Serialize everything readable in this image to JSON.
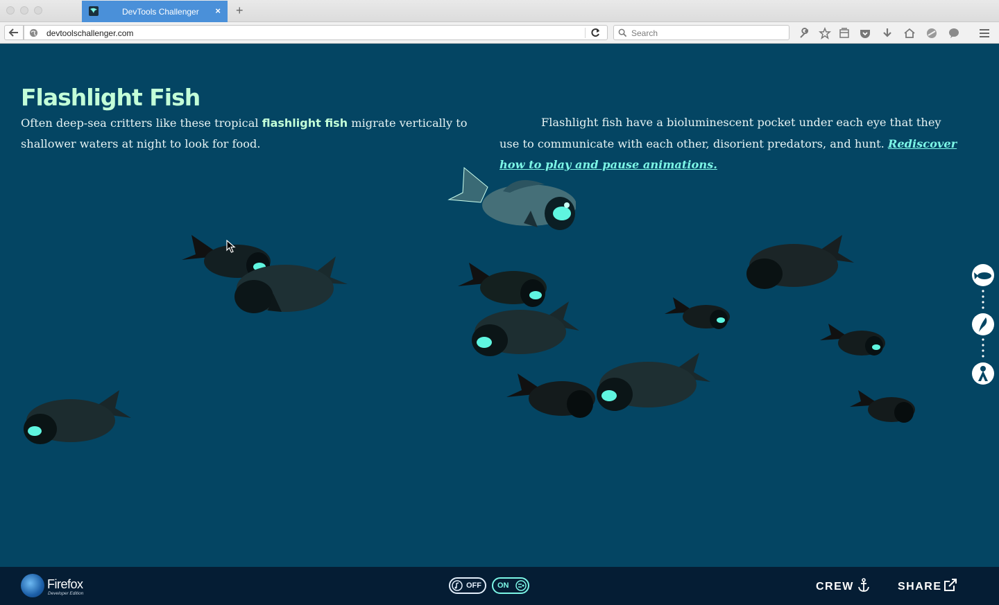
{
  "browser": {
    "tab_title": "DevTools Challenger",
    "tab_close": "×",
    "new_tab": "+",
    "url": "devtoolschallenger.com",
    "search_placeholder": "Search",
    "toolbar_icons": [
      "wrench-icon",
      "star-icon",
      "library-icon",
      "pocket-icon",
      "download-icon",
      "home-icon",
      "sync-icon",
      "chat-icon",
      "menu-icon"
    ]
  },
  "page": {
    "title": "Flashlight Fish",
    "intro_before": "Often deep-sea critters like these tropical ",
    "intro_bold": "flashlight fish",
    "intro_after": " migrate vertically to shallower waters at night to look for food.",
    "desc_text": "Flashlight fish have a bioluminescent pocket under each eye that they use to communicate with each other, disorient predators, and hunt. ",
    "desc_link": "Rediscover how to play and pause animations."
  },
  "side_nav": [
    "fish-nav-icon",
    "squid-nav-icon",
    "diver-nav-icon"
  ],
  "footer": {
    "brand": "Firefox",
    "edition": "Developer Edition",
    "sound_toggle": "OFF",
    "motion_toggle": "ON",
    "crew": "CREW",
    "share": "SHARE"
  },
  "colors": {
    "ocean": "#044563",
    "title": "#c3ffd8",
    "glow": "#5ff5e0",
    "footer": "#051d34",
    "tab": "#4a90d9"
  }
}
